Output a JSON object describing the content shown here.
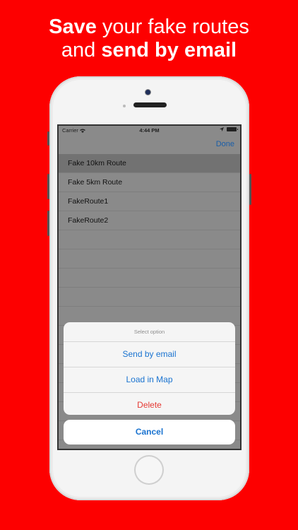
{
  "headline": {
    "line1_bold": "Save",
    "line1_rest": " your fake routes",
    "line2_rest": "and ",
    "line2_bold": "send by email"
  },
  "status_bar": {
    "carrier": "Carrier",
    "time": "4:44 PM"
  },
  "nav": {
    "done_label": "Done"
  },
  "routes": [
    {
      "name": "Fake 10km Route",
      "selected": true
    },
    {
      "name": "Fake 5km Route"
    },
    {
      "name": "FakeRoute1"
    },
    {
      "name": "FakeRoute2"
    }
  ],
  "action_sheet": {
    "title": "Select option",
    "options": [
      "Send by email",
      "Load in Map",
      "Delete"
    ],
    "cancel_label": "Cancel"
  },
  "colors": {
    "background": "#fd0000",
    "accent": "#1a73d0",
    "destructive": "#e53a34"
  },
  "icons": [
    "wifi-icon",
    "location-arrow-icon",
    "battery-icon"
  ]
}
